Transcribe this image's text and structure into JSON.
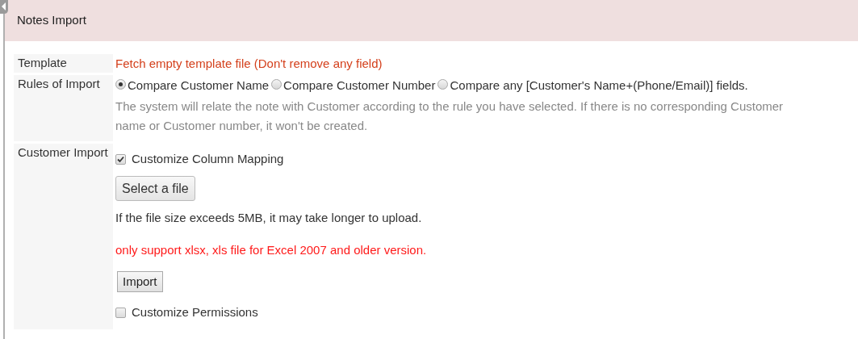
{
  "header": {
    "title": "Notes Import"
  },
  "template": {
    "label": "Template",
    "link": "Fetch empty template file (Don't remove any field)"
  },
  "rules": {
    "label": "Rules of Import",
    "options": [
      {
        "label": "Compare Customer Name",
        "selected": true
      },
      {
        "label": "Compare Customer Number",
        "selected": false
      },
      {
        "label": "Compare any [Customer's Name+(Phone/Email)] fields.",
        "selected": false
      }
    ],
    "note": "The system will relate the note with Customer according to the rule you have selected. If there is no corresponding Customer name or Customer number, it won't be created."
  },
  "customer_import": {
    "label": "Customer Import",
    "mapping": {
      "label": "Customize Column Mapping",
      "checked": true
    },
    "select_button": "Select a file",
    "size_note": "If the file size exceeds 5MB, it may take longer to upload.",
    "format_warning": "only support xlsx, xls file for Excel 2007 and older version.",
    "import_button": "Import",
    "permissions": {
      "label": "Customize Permissions",
      "checked": false
    }
  }
}
